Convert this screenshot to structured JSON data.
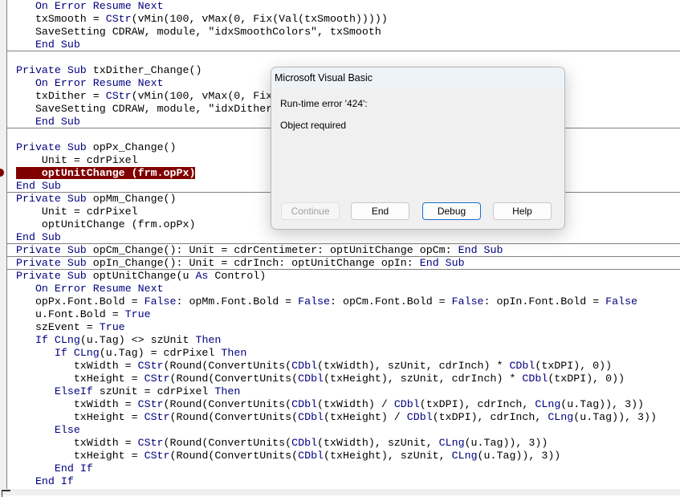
{
  "editor": {
    "keywords": [
      "Private",
      "Sub",
      "On",
      "Error",
      "Resume",
      "Next",
      "End",
      "CStr",
      "False",
      "True",
      "If",
      "Then",
      "ElseIf",
      "Else",
      "As",
      "CDbl",
      "CLng"
    ],
    "highlighted_line": 13,
    "separators_after": [
      3,
      9,
      14,
      18,
      19,
      20
    ],
    "lines": [
      "   On Error Resume Next",
      "   txSmooth = CStr(vMin(100, vMax(0, Fix(Val(txSmooth)))))",
      "   SaveSetting CDRAW, module, \"idxSmoothColors\", txSmooth",
      "   End Sub",
      "",
      "Private Sub txDither_Change()",
      "   On Error Resume Next",
      "   txDither = CStr(vMin(100, vMax(0, Fix",
      "   SaveSetting CDRAW, module, \"idxDither",
      "   End Sub",
      "",
      "Private Sub opPx_Change()",
      "    Unit = cdrPixel",
      "    optUnitChange (frm.opPx)",
      "End Sub",
      "Private Sub opMm_Change()",
      "    Unit = cdrPixel",
      "    optUnitChange (frm.opPx)",
      "End Sub",
      "Private Sub opCm_Change(): Unit = cdrCentimeter: optUnitChange opCm: End Sub",
      "Private Sub opIn_Change(): Unit = cdrInch: optUnitChange opIn: End Sub",
      "Private Sub optUnitChange(u As Control)",
      "   On Error Resume Next",
      "   opPx.Font.Bold = False: opMm.Font.Bold = False: opCm.Font.Bold = False: opIn.Font.Bold = False",
      "   u.Font.Bold = True",
      "   szEvent = True",
      "   If CLng(u.Tag) <> szUnit Then",
      "      If CLng(u.Tag) = cdrPixel Then",
      "         txWidth = CStr(Round(ConvertUnits(CDbl(txWidth), szUnit, cdrInch) * CDbl(txDPI), 0))",
      "         txHeight = CStr(Round(ConvertUnits(CDbl(txHeight), szUnit, cdrInch) * CDbl(txDPI), 0))",
      "      ElseIf szUnit = cdrPixel Then",
      "         txWidth = CStr(Round(ConvertUnits(CDbl(txWidth) / CDbl(txDPI), cdrInch, CLng(u.Tag)), 3))",
      "         txHeight = CStr(Round(ConvertUnits(CDbl(txHeight) / CDbl(txDPI), cdrInch, CLng(u.Tag)), 3))",
      "      Else",
      "         txWidth = CStr(Round(ConvertUnits(CDbl(txWidth), szUnit, CLng(u.Tag)), 3))",
      "         txHeight = CStr(Round(ConvertUnits(CDbl(txHeight), szUnit, CLng(u.Tag)), 3))",
      "      End If",
      "   End If"
    ]
  },
  "dialog": {
    "title": "Microsoft Visual Basic",
    "error_line": "Run-time error '424':",
    "message": "Object required",
    "buttons": {
      "continue": "Continue",
      "end": "End",
      "debug": "Debug",
      "help": "Help"
    }
  },
  "colors": {
    "keyword": "#00007f",
    "highlight": "#800000"
  }
}
